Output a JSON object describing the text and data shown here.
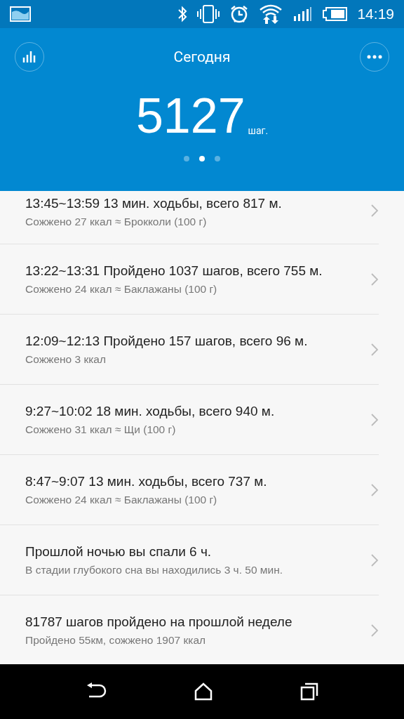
{
  "status_bar": {
    "time": "14:19"
  },
  "header": {
    "title": "Сегодня",
    "steps": "5127",
    "unit": "шаг.",
    "pages": [
      {
        "selected": false
      },
      {
        "selected": true
      },
      {
        "selected": false
      }
    ]
  },
  "entries": [
    {
      "title": "13:45~13:59  13 мин. ходьбы,  всего 817 м.",
      "subtitle": "Сожжено 27 ккал ≈ Брокколи (100 г)"
    },
    {
      "title": "13:22~13:31  Пройдено 1037 шагов,  всего 755 м.",
      "subtitle": "Сожжено 24 ккал ≈ Баклажаны (100 г)"
    },
    {
      "title": "12:09~12:13  Пройдено 157 шагов,  всего 96 м.",
      "subtitle": "Сожжено 3 ккал"
    },
    {
      "title": "9:27~10:02  18 мин. ходьбы,  всего 940 м.",
      "subtitle": "Сожжено 31 ккал ≈ Щи (100 г)"
    },
    {
      "title": "8:47~9:07  13 мин. ходьбы,  всего 737 м.",
      "subtitle": "Сожжено 24 ккал ≈ Баклажаны (100 г)"
    },
    {
      "title": "Прошлой ночью вы спали 6 ч.",
      "subtitle": "В стадии глубокого сна вы находились 3 ч. 50 мин."
    },
    {
      "title": "81787 шагов пройдено на прошлой неделе",
      "subtitle": "Пройдено 55км, сожжено 1907 ккал"
    }
  ]
}
